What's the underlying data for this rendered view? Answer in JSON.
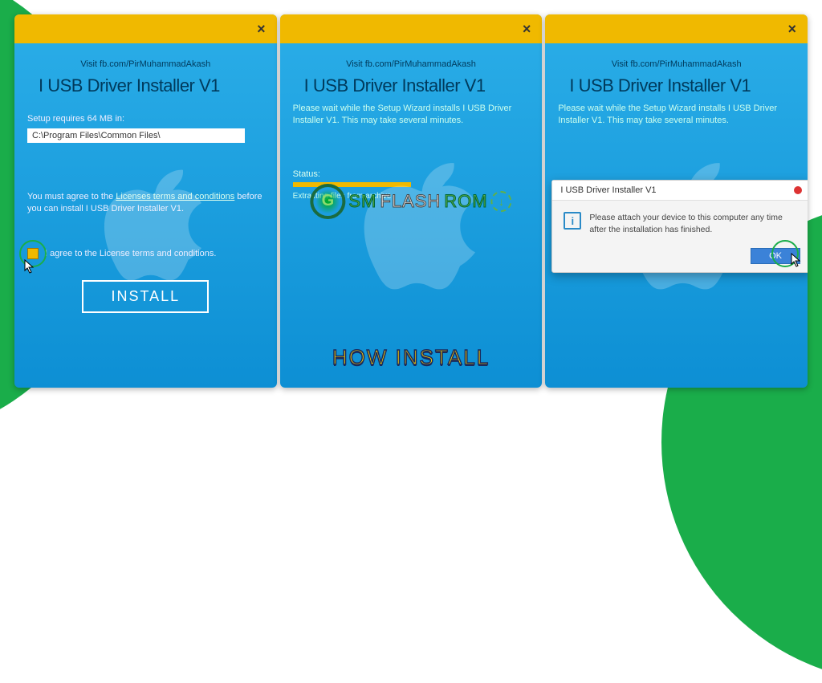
{
  "common": {
    "visit_text": "Visit fb.com/PirMuhammadAkash",
    "product_title": "I USB Driver Installer V1",
    "close_label": "×"
  },
  "panel1": {
    "setup_requires": "Setup requires 64 MB in:",
    "install_path": "C:\\Program Files\\Common Files\\",
    "agree_prefix": "You must agree to the ",
    "agree_link": "Licenses terms and conditions",
    "agree_suffix": " before you can install I USB Driver Installer V1.",
    "checkbox_label": "I agree to the License terms and conditions.",
    "install_button": "INSTALL"
  },
  "panel2": {
    "wait_text": "Please wait while the Setup Wizard installs I USB Driver Installer V1.  This may take several minutes.",
    "status_label": "Status:",
    "status_detail": "Extracting files from archive",
    "overlay_text": "HOW INSTALL"
  },
  "panel3": {
    "wait_text": "Please wait while the Setup Wizard installs I USB Driver Installer V1.  This may take several minutes.",
    "dialog": {
      "title": "I USB Driver Installer V1",
      "message": "Please attach your device to this computer any time after the installation has finished.",
      "ok_label": "OK"
    }
  },
  "watermark": {
    "part1": "SM",
    "part2": "FLASH",
    "part3": "ROM",
    "g": "G"
  }
}
